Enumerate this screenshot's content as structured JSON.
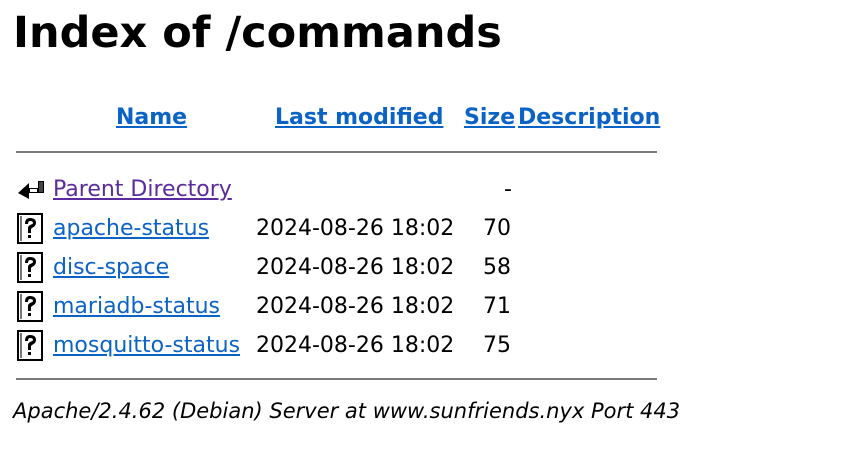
{
  "page": {
    "title": "Index of /commands"
  },
  "table": {
    "headers": {
      "name": "Name",
      "last_modified": "Last modified",
      "size": "Size",
      "description": "Description"
    },
    "parent": {
      "name": "Parent Directory",
      "size": "-",
      "icon": "back-arrow-icon"
    },
    "rows": [
      {
        "name": "apache-status",
        "modified": "2024-08-26 18:02",
        "size": "70",
        "icon": "unknown-file-icon"
      },
      {
        "name": "disc-space",
        "modified": "2024-08-26 18:02",
        "size": "58",
        "icon": "unknown-file-icon"
      },
      {
        "name": "mariadb-status",
        "modified": "2024-08-26 18:02",
        "size": "71",
        "icon": "unknown-file-icon"
      },
      {
        "name": "mosquitto-status",
        "modified": "2024-08-26 18:02",
        "size": "75",
        "icon": "unknown-file-icon"
      }
    ]
  },
  "footer": {
    "address": "Apache/2.4.62 (Debian) Server at www.sunfriends.nyx Port 443"
  },
  "colors": {
    "link": "#0b63c6",
    "visited_link": "#5b2b9d",
    "rule": "#7a7a7a"
  }
}
